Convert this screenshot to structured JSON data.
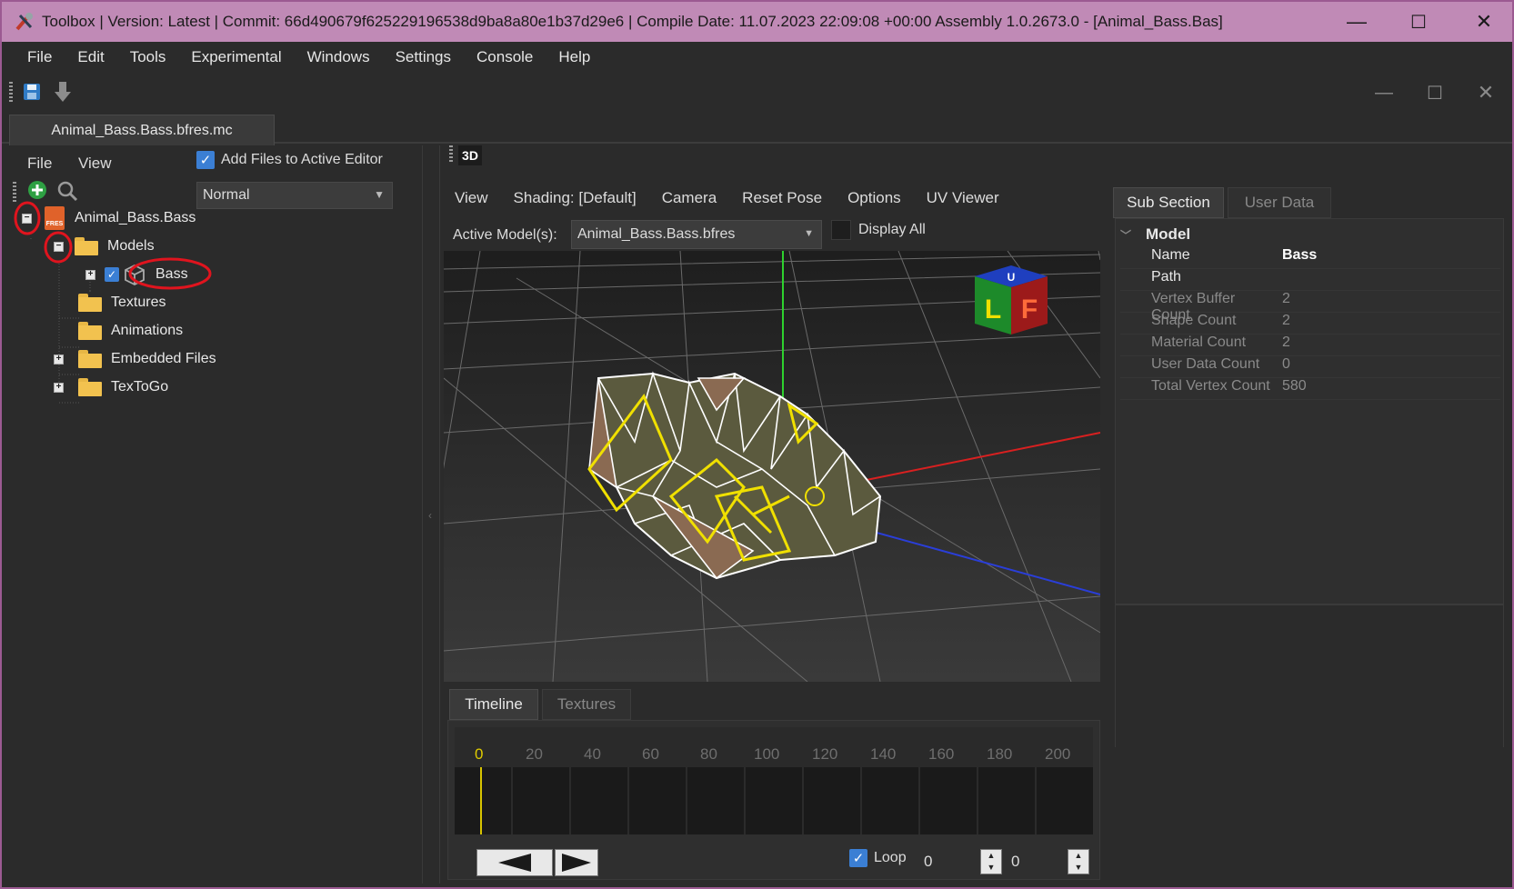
{
  "window": {
    "title": "Toolbox | Version: Latest | Commit: 66d490679f625229196538d9ba8a80e1b37d29e6 | Compile Date: 11.07.2023 22:09:08 +00:00 Assembly 1.0.2673.0 - [Animal_Bass.Bas]",
    "minimize": "—",
    "maximize": "☐",
    "close": "✕"
  },
  "menubar": [
    "File",
    "Edit",
    "Tools",
    "Experimental",
    "Windows",
    "Settings",
    "Console",
    "Help"
  ],
  "document_tab": "Animal_Bass.Bass.bfres.mc",
  "left_panel": {
    "menu": [
      "File",
      "View"
    ],
    "add_files_label": "Add Files to Active Editor",
    "add_files_checked": true,
    "mode_select": "Normal",
    "tree": {
      "root": "Animal_Bass.Bass",
      "root_icon_text": "FRES",
      "models": "Models",
      "bass": "Bass",
      "textures": "Textures",
      "animations": "Animations",
      "embedded": "Embedded Files",
      "textogo": "TexToGo"
    }
  },
  "viewport": {
    "tab_label": "3D",
    "menu": [
      "View",
      "Shading: [Default]",
      "Camera",
      "Reset Pose",
      "Options",
      "UV Viewer"
    ],
    "active_models_label": "Active Model(s):",
    "active_model": "Animal_Bass.Bass.bfres",
    "display_all_label": "Display All",
    "cube_letters": {
      "top": "U",
      "left": "L",
      "front": "F"
    }
  },
  "timeline": {
    "tabs": [
      "Timeline",
      "Textures"
    ],
    "ticks": [
      "0",
      "20",
      "40",
      "60",
      "80",
      "100",
      "120",
      "140",
      "160",
      "180",
      "200"
    ],
    "loop_label": "Loop",
    "loop_checked": true,
    "frame": "0",
    "end_frame": "0"
  },
  "right_panel": {
    "tabs": [
      "Sub Section",
      "User Data"
    ],
    "section": "Model",
    "properties": [
      {
        "key": "Name",
        "value": "Bass"
      },
      {
        "key": "Path",
        "value": ""
      },
      {
        "key": "Vertex Buffer Count",
        "value": "2"
      },
      {
        "key": "Shape Count",
        "value": "2"
      },
      {
        "key": "Material Count",
        "value": "2"
      },
      {
        "key": "User Data Count",
        "value": "0"
      },
      {
        "key": "Total Vertex Count",
        "value": "580"
      }
    ]
  },
  "colors": {
    "titlebar": "#c08ab6",
    "annotation": "#e0141e",
    "selection_yellow": "#f0e000"
  }
}
